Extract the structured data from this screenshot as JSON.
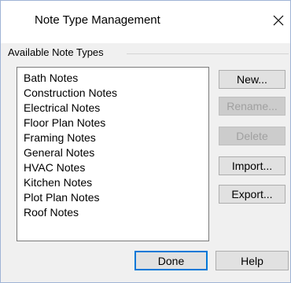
{
  "window": {
    "title": "Note Type Management"
  },
  "group": {
    "label": "Available Note Types"
  },
  "note_types": [
    "Bath Notes",
    "Construction Notes",
    "Electrical Notes",
    "Floor Plan Notes",
    "Framing Notes",
    "General Notes",
    "HVAC Notes",
    "Kitchen Notes",
    "Plot Plan Notes",
    "Roof Notes"
  ],
  "buttons": {
    "new": "New...",
    "rename": "Rename...",
    "delete": "Delete",
    "import": "Import...",
    "export": "Export...",
    "done": "Done",
    "help": "Help"
  },
  "icons": {
    "close": "close-icon"
  }
}
